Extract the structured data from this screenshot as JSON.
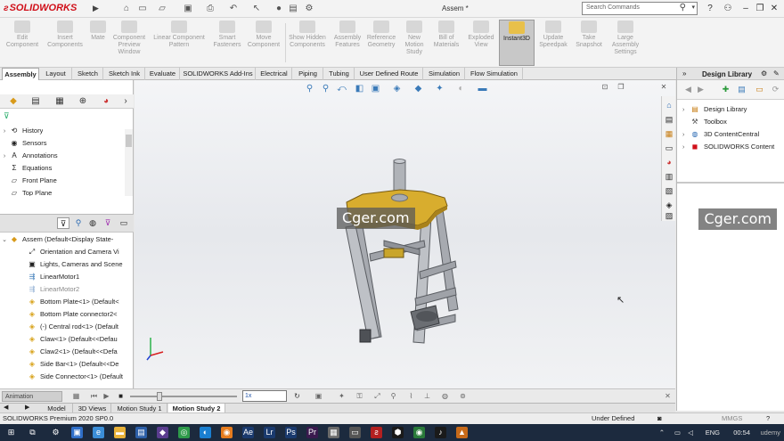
{
  "app": {
    "logo_text": "SOLIDWORKS",
    "document_title": "Assem *",
    "search_placeholder": "Search Commands"
  },
  "ribbon": {
    "buttons": [
      {
        "label": "Edit Component",
        "enabled": false
      },
      {
        "label": "Insert Components",
        "enabled": false
      },
      {
        "label": "Mate",
        "enabled": false
      },
      {
        "label": "Component Preview Window",
        "enabled": false
      },
      {
        "label": "Linear Component Pattern",
        "enabled": false
      },
      {
        "label": "Smart Fasteners",
        "enabled": false
      },
      {
        "label": "Move Component",
        "enabled": false
      },
      {
        "label": "Show Hidden Components",
        "enabled": false
      },
      {
        "label": "Assembly Features",
        "enabled": false
      },
      {
        "label": "Reference Geometry",
        "enabled": false
      },
      {
        "label": "New Motion Study",
        "enabled": false
      },
      {
        "label": "Bill of Materials",
        "enabled": false
      },
      {
        "label": "Exploded View",
        "enabled": false
      },
      {
        "label": "Instant3D",
        "enabled": true,
        "active": true
      },
      {
        "label": "Update Speedpak",
        "enabled": false
      },
      {
        "label": "Take Snapshot",
        "enabled": false
      },
      {
        "label": "Large Assembly Settings",
        "enabled": false
      }
    ]
  },
  "tabs": [
    "Assembly",
    "Layout",
    "Sketch",
    "Sketch Ink",
    "Evaluate",
    "SOLIDWORKS Add-Ins",
    "Electrical",
    "Piping",
    "Tubing",
    "User Defined Route",
    "Simulation",
    "Flow Simulation"
  ],
  "active_tab": "Assembly",
  "tree_top": [
    {
      "label": "History",
      "icon": "history-icon"
    },
    {
      "label": "Sensors",
      "icon": "sensor-icon"
    },
    {
      "label": "Annotations",
      "icon": "annotation-icon"
    },
    {
      "label": "Equations",
      "icon": "equation-icon"
    },
    {
      "label": "Front Plane",
      "icon": "plane-icon"
    },
    {
      "label": "Top Plane",
      "icon": "plane-icon"
    }
  ],
  "tree_bottom": [
    {
      "label": "Assem  (Default<Display State-",
      "icon": "assembly-icon"
    },
    {
      "label": "Orientation and Camera Vi",
      "icon": "camera-icon"
    },
    {
      "label": "Lights, Cameras and Scene",
      "icon": "light-icon"
    },
    {
      "label": "LinearMotor1",
      "icon": "motor-icon"
    },
    {
      "label": "LinearMotor2",
      "icon": "motor-icon"
    },
    {
      "label": "Bottom Plate<1> (Default<",
      "icon": "part-icon"
    },
    {
      "label": "Bottom Plate connector2<",
      "icon": "part-icon"
    },
    {
      "label": "(-) Central rod<1> (Default",
      "icon": "part-icon"
    },
    {
      "label": "Claw<1> (Default<<Defau",
      "icon": "part-icon"
    },
    {
      "label": "Claw2<1> (Default<<Defa",
      "icon": "part-icon"
    },
    {
      "label": "Side Bar<1> (Default<<De",
      "icon": "part-icon"
    },
    {
      "label": "Side Connector<1> (Default",
      "icon": "part-icon"
    }
  ],
  "watermark": "Cger.com",
  "design_library": {
    "title": "Design Library",
    "items": [
      {
        "label": "Design Library",
        "icon": "folder-icon"
      },
      {
        "label": "Toolbox",
        "icon": "toolbox-icon"
      },
      {
        "label": "3D ContentCentral",
        "icon": "globe-icon"
      },
      {
        "label": "SOLIDWORKS Content",
        "icon": "sw-content-icon"
      }
    ]
  },
  "animation": {
    "mode": "Animation",
    "speed": "1x"
  },
  "model_tabs": [
    "Model",
    "3D Views",
    "Motion Study 1",
    "Motion Study 2"
  ],
  "active_model_tab": "Motion Study 2",
  "status": {
    "product": "SOLIDWORKS Premium 2020 SP0.0",
    "state": "Under Defined",
    "units": "MMGS"
  },
  "taskbar": {
    "language": "ENG",
    "time": "00:54",
    "overlay": "udemy"
  },
  "colors": {
    "brand": "#d0101a",
    "active_ribbon": "#e8c04a",
    "taskbar": "#1c2a3e"
  }
}
